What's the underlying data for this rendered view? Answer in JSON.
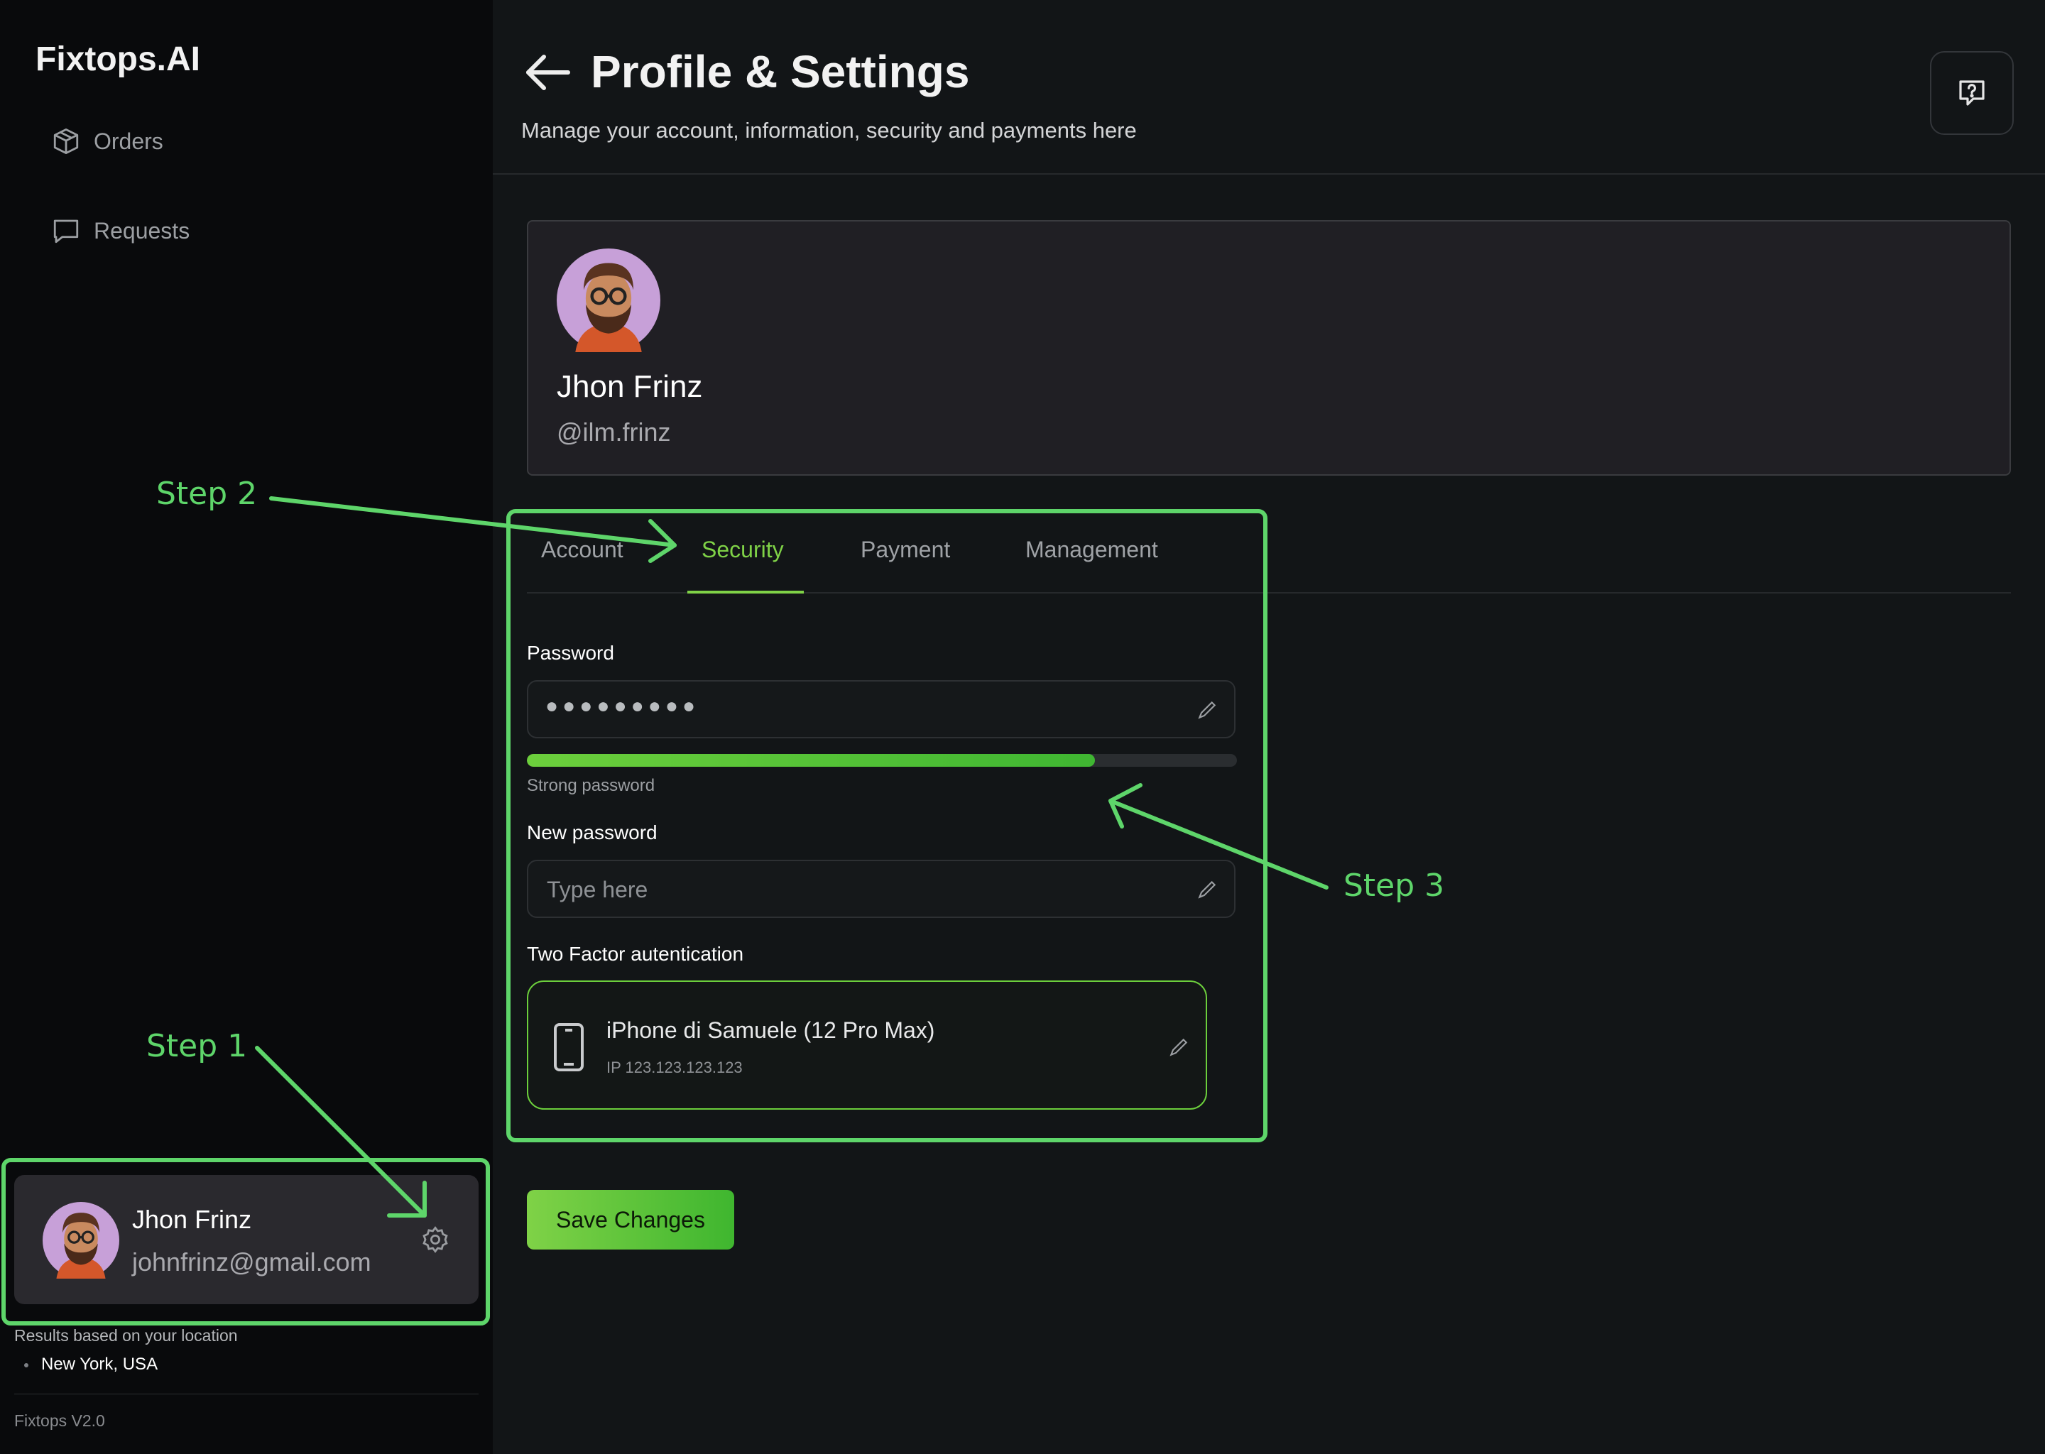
{
  "sidebar": {
    "logo": "Fixtops.AI",
    "items": [
      {
        "label": "Orders",
        "icon": "box-icon"
      },
      {
        "label": "Requests",
        "icon": "chat-icon"
      }
    ],
    "user": {
      "name": "Jhon Frinz",
      "email": "johnfrinz@gmail.com"
    },
    "location_note": "Results based on your location",
    "location": "New York, USA",
    "version": "Fixtops V2.0"
  },
  "header": {
    "title": "Profile & Settings",
    "subtitle": "Manage your account, information, security and payments here"
  },
  "profile": {
    "name": "Jhon Frinz",
    "handle": "@ilm.frinz"
  },
  "tabs": [
    {
      "label": "Account"
    },
    {
      "label": "Security",
      "active": true
    },
    {
      "label": "Payment"
    },
    {
      "label": "Management"
    }
  ],
  "security": {
    "password_label": "Password",
    "password_mask": "●●●●●●●●●",
    "strength_fraction": 0.8,
    "strength_text": "Strong password",
    "new_password_label": "New password",
    "new_password_placeholder": "Type here",
    "new_password_value": "",
    "two_factor_label": "Two Factor autentication",
    "device": {
      "name": "iPhone di Samuele (12 Pro Max)",
      "ip": "IP 123.123.123.123"
    }
  },
  "save_label": "Save Changes",
  "annotations": {
    "step1": "Step 1",
    "step2": "Step 2",
    "step3": "Step 3"
  },
  "colors": {
    "accent": "#7fd247",
    "annotation": "#5ed56a",
    "background": "#121517",
    "sidebar": "#090a0c",
    "card": "#201f24"
  }
}
